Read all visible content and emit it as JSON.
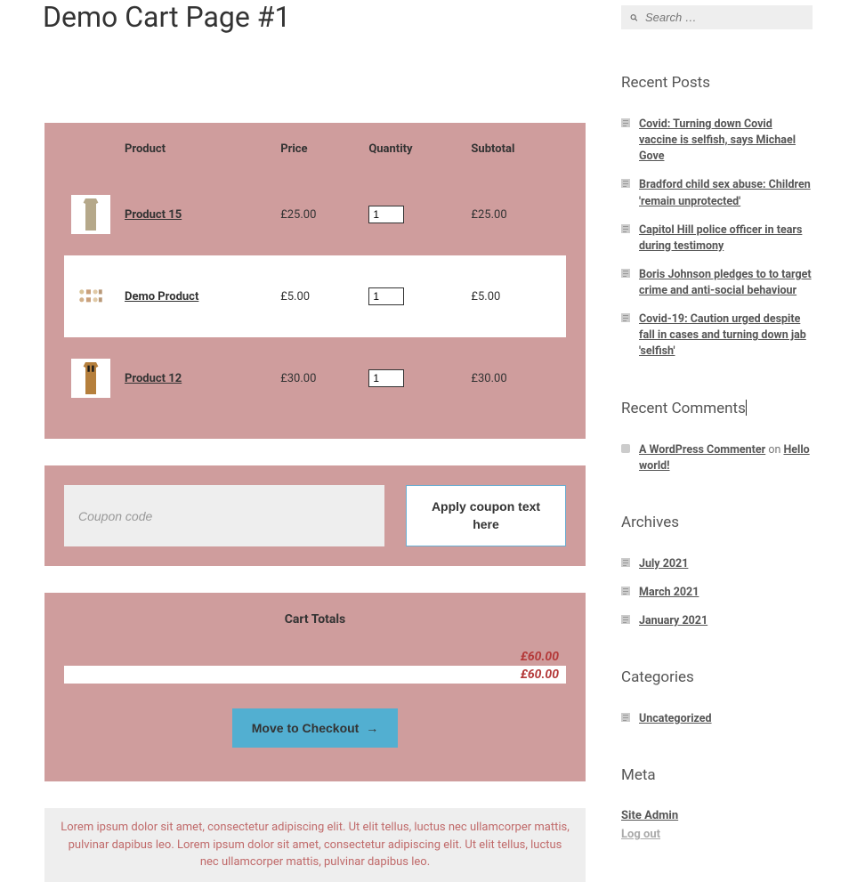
{
  "page_title": "Demo Cart Page #1",
  "cart": {
    "headers": {
      "product": "Product",
      "price": "Price",
      "quantity": "Quantity",
      "subtotal": "Subtotal"
    },
    "rows": [
      {
        "name": "Product 15",
        "price": "£25.00",
        "qty": "1",
        "subtotal": "£25.00"
      },
      {
        "name": "Demo Product",
        "price": "£5.00",
        "qty": "1",
        "subtotal": "£5.00"
      },
      {
        "name": "Product 12",
        "price": "£30.00",
        "qty": "1",
        "subtotal": "£30.00"
      }
    ]
  },
  "coupon": {
    "placeholder": "Coupon code",
    "apply_label": "Apply coupon text here"
  },
  "totals": {
    "title": "Cart Totals",
    "subtotal": "£60.00",
    "total": "£60.00",
    "checkout_label": "Move to Checkout"
  },
  "lorem": "Lorem ipsum dolor sit amet, consectetur adipiscing elit. Ut elit tellus, luctus nec ullamcorper mattis, pulvinar dapibus leo. Lorem ipsum dolor sit amet, consectetur adipiscing elit. Ut elit tellus, luctus nec ullamcorper mattis, pulvinar dapibus leo.",
  "sidebar": {
    "search_placeholder": "Search …",
    "recent_posts_heading": "Recent Posts",
    "recent_posts": [
      "Covid: Turning down Covid vaccine is selfish, says Michael Gove",
      "Bradford child sex abuse: Children 'remain unprotected'",
      "Capitol Hill police officer in tears during testimony",
      "Boris Johnson pledges to to target crime and anti-social behaviour",
      "Covid-19: Caution urged despite fall in cases and turning down jab 'selfish'"
    ],
    "recent_comments_heading": "Recent Comments",
    "recent_comments": [
      {
        "author": "A WordPress Commenter",
        "on": " on ",
        "post": "Hello world!"
      }
    ],
    "archives_heading": "Archives",
    "archives": [
      "July 2021",
      "March 2021",
      "January 2021"
    ],
    "categories_heading": "Categories",
    "categories": [
      "Uncategorized"
    ],
    "meta_heading": "Meta",
    "meta": {
      "site_admin": "Site Admin",
      "logout": "Log out"
    }
  }
}
